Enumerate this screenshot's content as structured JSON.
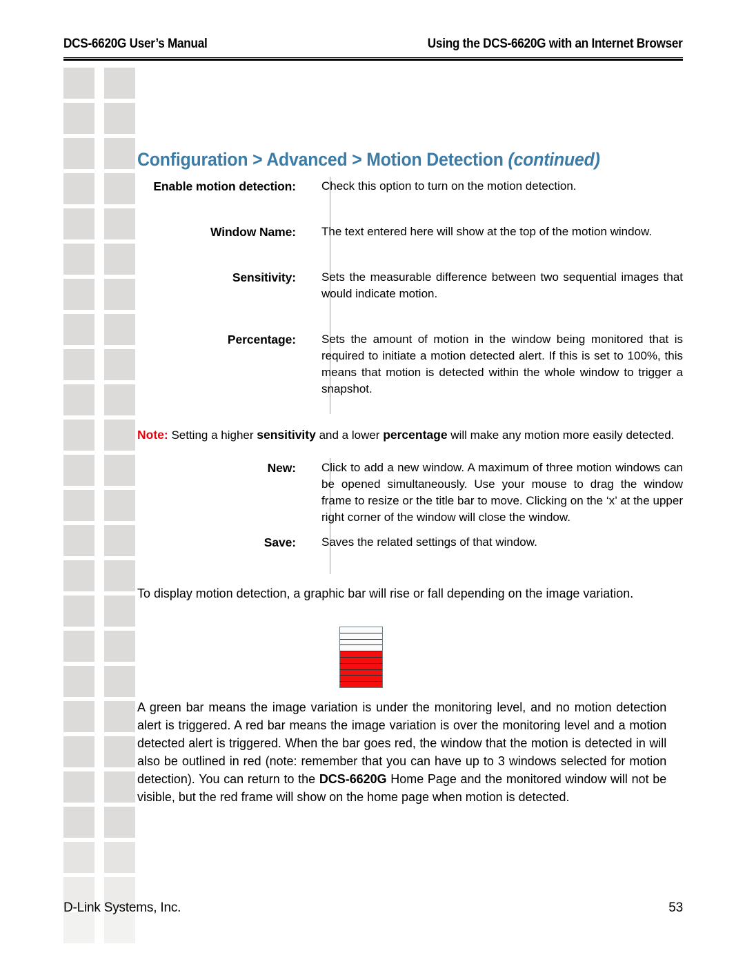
{
  "header": {
    "left": "DCS-6620G User’s Manual",
    "right": "Using the DCS-6620G with an Internet Browser"
  },
  "section": {
    "title_main": "Configuration > Advanced > Motion Detection ",
    "title_continued": "(continued)"
  },
  "definitions": [
    {
      "label": "Enable motion detection:",
      "desc": "Check this option to turn on the motion detection."
    },
    {
      "label": "Window Name:",
      "desc": "The text entered here will show at the top of the motion window."
    },
    {
      "label": "Sensitivity:",
      "desc": "Sets the measurable difference between two sequential images that would indicate motion."
    },
    {
      "label": "Percentage:",
      "desc": "Sets the amount of motion in the window being monitored that is required to initiate a motion detected alert. If this is set to 100%, this means that motion is detected within the whole window to trigger a snapshot."
    }
  ],
  "note": {
    "keyword": "Note:",
    "part1": " Setting a higher ",
    "bold1": "sensitivity",
    "part2": " and a lower ",
    "bold2": "percentage",
    "part3": " will make any motion more easily detected."
  },
  "definitions2": [
    {
      "label": "New:",
      "desc": "Click to add a new window. A maximum of three motion windows can be opened simultaneously. Use your mouse to drag the window frame to resize or the title bar to move. Clicking on the ‘x’ at the upper right corner of the window will close the window."
    },
    {
      "label": "Save:",
      "desc": "Saves the related settings of that window."
    }
  ],
  "intro_bar_text": "To display motion detection, a graphic bar will rise or fall depending on the image variation.",
  "graphic_bar": {
    "segments": [
      "white",
      "white",
      "white",
      "white",
      "red",
      "red",
      "red",
      "red",
      "red",
      "red"
    ],
    "white_color": "#fbfbfb",
    "red_color": "#f60d0d",
    "border_color": "#6f7b7e"
  },
  "closing": {
    "part1": "A green bar means the image variation is under the monitoring level, and no motion detection alert is triggered. A red bar means the image variation is over the monitoring level and a motion detected alert is triggered.  When the bar goes red, the window that the motion is detected in will also be outlined in red (note: remember that you can have up to 3 windows selected for motion detection). You can return to the ",
    "bold1": "DCS-6620G",
    "part2": " Home Page and the monitored window will not be visible, but the red frame will show on the home page when motion is detected."
  },
  "footer": {
    "left": "D-Link Systems, Inc.",
    "right": "53"
  },
  "colors": {
    "title_blue": "#3b7ba6",
    "note_red": "#e8000d",
    "square_gray": "#dddbd9",
    "divider_gray": "#9b9b9b"
  }
}
